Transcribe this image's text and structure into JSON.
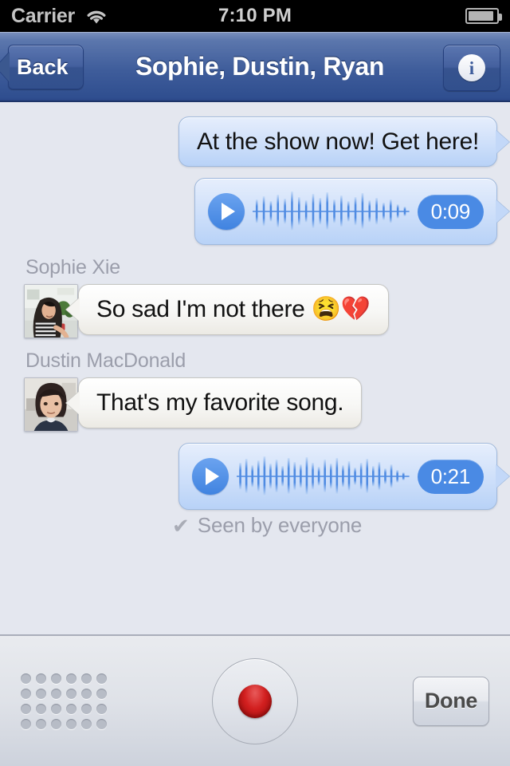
{
  "status_bar": {
    "carrier": "Carrier",
    "wifi_icon": "wifi-icon",
    "time": "7:10 PM",
    "battery_icon": "battery-icon"
  },
  "nav_bar": {
    "back_label": "Back",
    "title": "Sophie, Dustin, Ryan",
    "info_glyph": "i",
    "info_icon": "info-circle-icon"
  },
  "thread": {
    "messages": [
      {
        "kind": "text",
        "direction": "outgoing",
        "text": "At the show now! Get here!"
      },
      {
        "kind": "audio",
        "direction": "outgoing",
        "play_icon": "play-icon",
        "duration": "0:09"
      },
      {
        "kind": "text",
        "direction": "incoming",
        "sender": "Sophie Xie",
        "avatar": "avatar-sophie",
        "text": "So sad I'm not there 😫💔"
      },
      {
        "kind": "text",
        "direction": "incoming",
        "sender": "Dustin MacDonald",
        "avatar": "avatar-dustin",
        "text": "That's my favorite song."
      },
      {
        "kind": "audio",
        "direction": "outgoing",
        "play_icon": "play-icon",
        "duration": "0:21"
      }
    ],
    "receipt": {
      "check_icon": "✔",
      "text": "Seen by everyone"
    }
  },
  "toolbar": {
    "mic_icon": "microphone-grille-icon",
    "record_icon": "record-button-icon",
    "done_label": "Done"
  },
  "colors": {
    "background": "#e4e7ef",
    "nav_bar_top": "#7a90bd",
    "nav_bar_bottom": "#2b4787",
    "outgoing_bubble": "#cfe0fa",
    "incoming_bubble": "#f7f7f5",
    "accent_blue": "#4a8ae4",
    "record_red": "#d21f1f",
    "muted_text": "#9b9eab"
  }
}
